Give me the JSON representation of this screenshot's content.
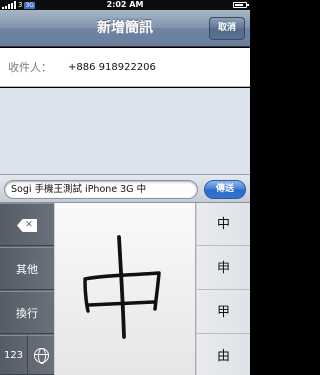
{
  "status_bar": {
    "carrier": "3",
    "network": "3G",
    "time": "2:02 AM",
    "battery_level": 0.75
  },
  "nav": {
    "title": "新增簡訊",
    "cancel_label": "取消"
  },
  "recipient": {
    "label": "收件人：",
    "value": "+886 918922206"
  },
  "compose": {
    "text": "Sogi 手機王測試 iPhone 3G 中",
    "send_label": "傳送"
  },
  "keyboard": {
    "other_label": "其他",
    "newline_label": "換行",
    "numbers_label": "123",
    "handwritten_char": "中",
    "candidates": [
      "中",
      "申",
      "甲",
      "由"
    ]
  },
  "colors": {
    "navbar": "#7f93ad",
    "send_button": "#3474d0",
    "keyboard_side": "#5f6671"
  }
}
